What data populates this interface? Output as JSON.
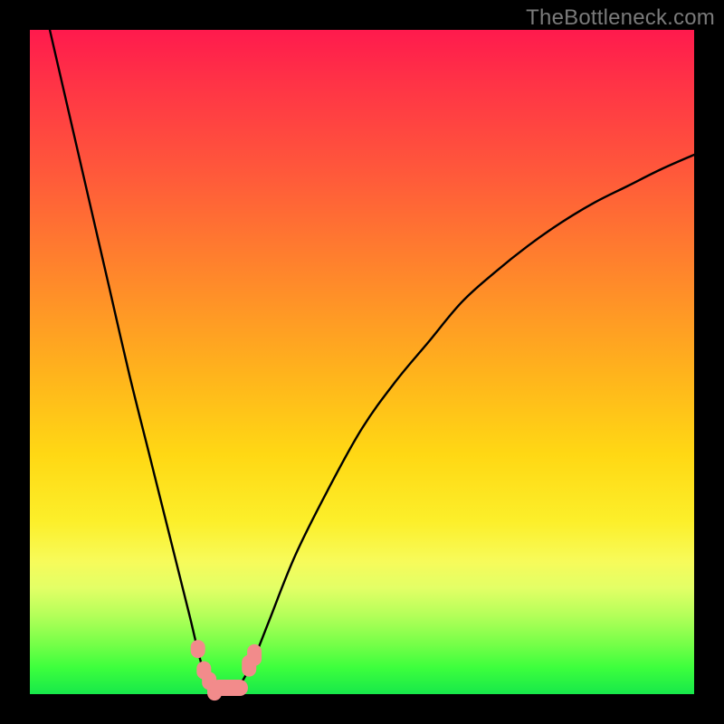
{
  "watermark": "TheBottleneck.com",
  "chart_data": {
    "type": "line",
    "title": "",
    "xlabel": "",
    "ylabel": "",
    "xlim": [
      0,
      1
    ],
    "ylim": [
      0,
      1
    ],
    "series": [
      {
        "name": "bottleneck-curve",
        "x": [
          0.03,
          0.06,
          0.09,
          0.12,
          0.15,
          0.18,
          0.21,
          0.24,
          0.26,
          0.28,
          0.3,
          0.32,
          0.34,
          0.36,
          0.4,
          0.45,
          0.5,
          0.55,
          0.6,
          0.65,
          0.7,
          0.75,
          0.8,
          0.85,
          0.9,
          0.95,
          1.0
        ],
        "values": [
          1.0,
          0.87,
          0.74,
          0.61,
          0.48,
          0.36,
          0.24,
          0.12,
          0.04,
          0.0,
          0.0,
          0.02,
          0.06,
          0.11,
          0.21,
          0.31,
          0.4,
          0.47,
          0.53,
          0.59,
          0.635,
          0.675,
          0.71,
          0.74,
          0.765,
          0.79,
          0.812
        ]
      }
    ],
    "annotations": [
      {
        "name": "optimal-zone-marker",
        "x0": 0.254,
        "x1": 0.338,
        "note": "pink marker cluster near minimum"
      }
    ],
    "gradient": {
      "top_color": "#ff1a4d",
      "bottom_color": "#17e84a"
    }
  }
}
